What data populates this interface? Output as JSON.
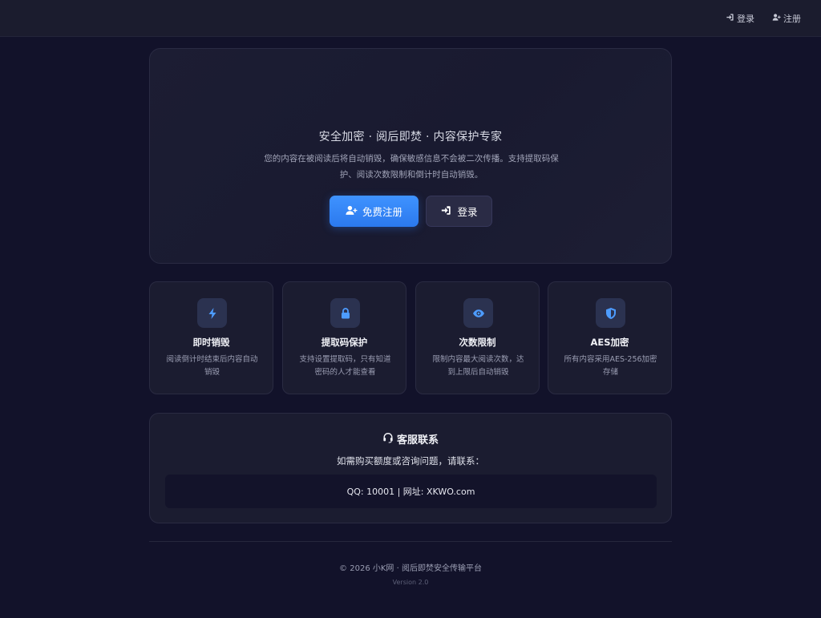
{
  "nav": {
    "login_label": "登录",
    "register_label": "注册"
  },
  "hero": {
    "title": "安全加密 · 阅后即焚 · 内容保护专家",
    "description": "您的内容在被阅读后将自动销毁，确保敏感信息不会被二次传播。支持提取码保护、阅读次数限制和倒计时自动销毁。",
    "primary_button": "免费注册",
    "secondary_button": "登录"
  },
  "features": [
    {
      "icon": "lightning-icon",
      "title": "即时销毁",
      "description": "阅读倒计时结束后内容自动销毁"
    },
    {
      "icon": "lock-icon",
      "title": "提取码保护",
      "description": "支持设置提取码，只有知道密码的人才能查看"
    },
    {
      "icon": "eye-icon",
      "title": "次数限制",
      "description": "限制内容最大阅读次数，达到上限后自动销毁"
    },
    {
      "icon": "shield-icon",
      "title": "AES加密",
      "description": "所有内容采用AES-256加密存储"
    }
  ],
  "contact": {
    "title": "客服联系",
    "subtitle": "如需购买额度或咨询问题，请联系：",
    "details": "QQ: 10001 | 网址: XKWO.com"
  },
  "footer": {
    "copyright": "© 2026 小K网 · 阅后即焚安全传输平台",
    "version": "Version 2.0"
  },
  "colors": {
    "background": "#12122a",
    "accent": "#3f93ff",
    "icon_blue": "#4d9cff"
  }
}
